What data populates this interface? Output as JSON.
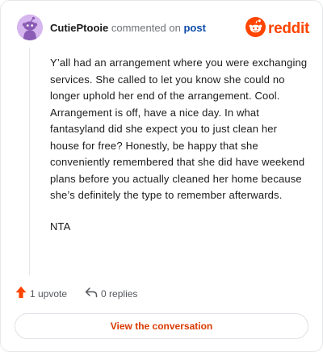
{
  "author": {
    "username": "CutiePtooie",
    "action_text": "commented on",
    "link_text": "post",
    "avatar_icon": "snoo-avatar-icon",
    "avatar_color": "#d6b6ef"
  },
  "brand": {
    "logo_icon": "reddit-snoo-icon",
    "wordmark": "reddit",
    "color": "#ff4500"
  },
  "comment": {
    "paragraphs": [
      "Y’all had an arrangement where you were exchanging services. She called to let you know she could no longer uphold her end of the arrangement. Cool. Arrangement is off, have a nice day. In what fantasyland did she expect you to just clean her house for free? Honestly, be happy that she conveniently remembered that she did have weekend plans before you actually cleaned her home because she’s definitely the type to remember afterwards.",
      "NTA"
    ]
  },
  "actions": {
    "upvote_label": "1 upvote",
    "upvote_icon": "upvote-arrow-icon",
    "upvote_color": "#ff4500",
    "reply_label": "0 replies",
    "reply_icon": "reply-arrow-icon"
  },
  "cta": {
    "label": "View the conversation",
    "color": "#d93a00"
  }
}
